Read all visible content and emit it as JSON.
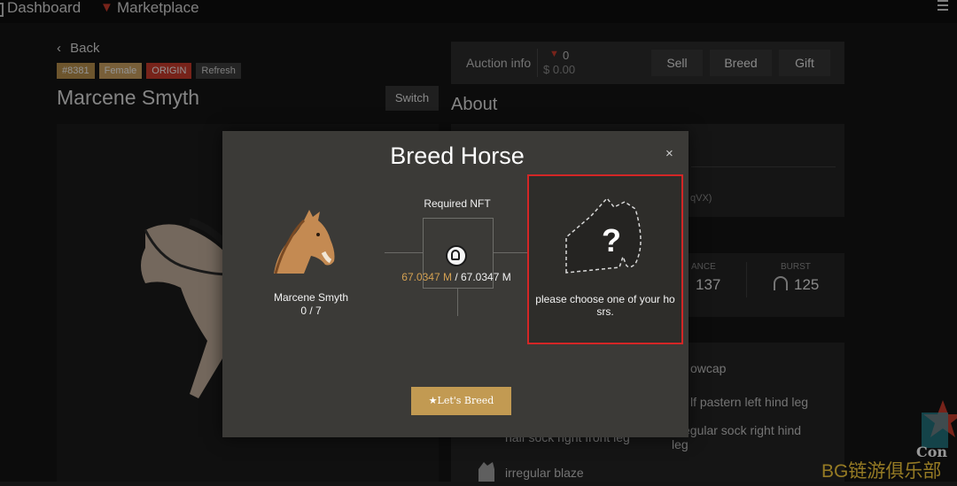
{
  "nav": {
    "dashboard": "Dashboard",
    "marketplace": "Marketplace"
  },
  "horse_page": {
    "back": "Back",
    "tags": [
      "#8381",
      "Female",
      "ORIGIN",
      "Refresh"
    ],
    "name": "Marcene Smyth",
    "switch": "Switch"
  },
  "auction": {
    "label": "Auction info",
    "count": "0",
    "price": "$ 0.00",
    "sell": "Sell",
    "breed": "Breed",
    "gift": "Gift"
  },
  "about": {
    "title": "About",
    "address_fragment": "qVX)"
  },
  "stats": {
    "stamina_label_fragment": "ANCE",
    "stamina_value": "137",
    "burst_label": "BURST",
    "burst_value": "125"
  },
  "traits": [
    "owcap",
    "lf pastern left hind leg",
    "egular sock right hind",
    "leg",
    "half sock right front leg",
    "irregular blaze"
  ],
  "watermark": {
    "text": "BG链游俱乐部",
    "logo_fragment": "Con"
  },
  "modal": {
    "title": "Breed Horse",
    "required_label": "Required NFT",
    "amount_have": "67.0347 M",
    "amount_sep": " / ",
    "amount_need": "67.0347 M",
    "horse_name": "Marcene Smyth",
    "horse_count": "0 / 7",
    "choose_text": "please choose one of your ho srs.",
    "cta": "★Let's Breed",
    "close": "×"
  },
  "colors": {
    "accent_gold": "#c29a52",
    "origin_red": "#c0392b",
    "highlight_red": "#d42626",
    "modal_bg": "#3b3a37"
  }
}
